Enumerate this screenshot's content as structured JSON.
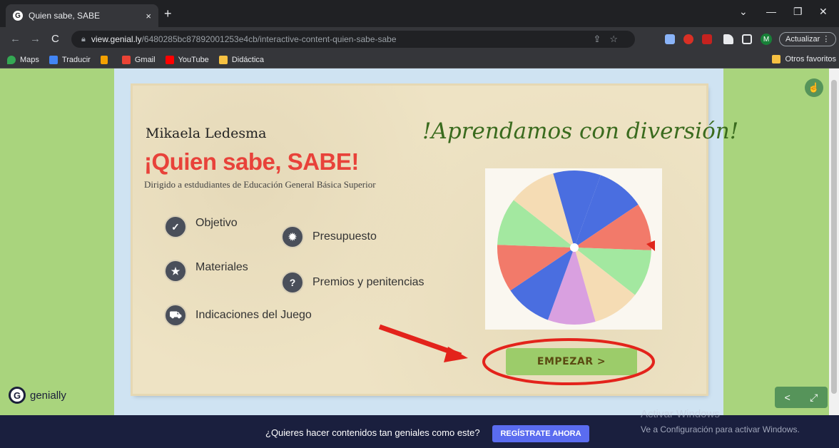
{
  "browser": {
    "tab_title": "Quien sabe, SABE",
    "tab_close": "×",
    "new_tab": "+",
    "url_host": "view.genial.ly",
    "url_path": "/6480285bc87892001253e4cb/interactive-content-quien-sabe-sabe",
    "profile_initial": "M",
    "update_label": "Actualizar",
    "bookmarks": [
      "Maps",
      "Traducir",
      "Gmail",
      "YouTube",
      "Didáctica"
    ],
    "other_bookmarks": "Otros favoritos"
  },
  "slide": {
    "author": "Mikaela Ledesma",
    "title": "¡Quien sabe, SABE!",
    "subtitle": "Dirigido a estdudiantes de Educación General Básica Superior",
    "headline": "!Aprendamos con diversión!",
    "menu": [
      {
        "label": "Objetivo",
        "icon": "check-icon"
      },
      {
        "label": "Presupuesto",
        "icon": "gear-icon"
      },
      {
        "label": "Materiales",
        "icon": "star-icon"
      },
      {
        "label": "Premios y penitencias",
        "icon": "question-icon"
      },
      {
        "label": "Indicaciones del Juego",
        "icon": "cart-icon"
      }
    ],
    "start_button": "EMPEZAR >",
    "wheel_colors": [
      "#4a6ee0",
      "#f27a6a",
      "#a3e8a0",
      "#f5dcb4",
      "#d9a0e0",
      "#4a6ee0",
      "#f27a6a",
      "#a3e8a0",
      "#f5dcb4",
      "#4a6ee0"
    ]
  },
  "branding": {
    "logo_text": "genially"
  },
  "footer": {
    "prompt": "¿Quieres hacer contenidos tan geniales como este?",
    "register_button": "REGÍSTRATE AHORA"
  },
  "windows_watermark": {
    "title": "Activar Windows",
    "subtitle": "Ve a Configuración para activar Windows."
  }
}
